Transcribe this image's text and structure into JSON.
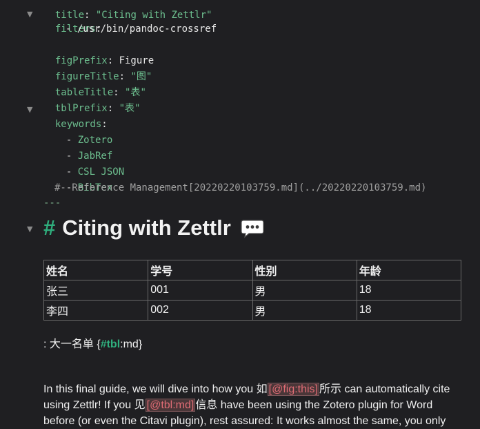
{
  "frontmatter": {
    "title_key": "title",
    "title_value": "\"Citing with Zettlr\"",
    "filters_key": "filters",
    "filter_item": "- /usr/bin/pandoc-crossref",
    "figPrefix_key": "figPrefix",
    "figPrefix_value": "Figure",
    "figureTitle_key": "figureTitle",
    "figureTitle_value": "\"图\"",
    "tableTitle_key": "tableTitle",
    "tableTitle_value": "\"表\"",
    "tblPrefix_key": "tblPrefix",
    "tblPrefix_value": "\"表\"",
    "keywords_key": "keywords",
    "keywords": [
      "Zotero",
      "JabRef",
      "CSL JSON",
      "BibTex"
    ],
    "comment_line": "#- Reference Management[20220220103759.md](../20220220103759.md)",
    "end_marker": "---"
  },
  "heading": {
    "hash": "#",
    "text": "Citing with Zettlr",
    "icon": "speech-bubble-icon"
  },
  "table": {
    "headers": [
      "姓名",
      "学号",
      "性别",
      "年龄"
    ],
    "rows": [
      [
        "张三",
        "001",
        "男",
        "18"
      ],
      [
        "李四",
        "002",
        "男",
        "18"
      ]
    ]
  },
  "caption": {
    "prefix": ": 大一名单 {",
    "tag": "#tbl",
    "suffix": ":md}"
  },
  "paragraph": {
    "p1": "In this final guide, we will dive into how you 如",
    "cite1": "[@fig:this]",
    "p2": "所示 can automatically cite using Zettlr! If you 见",
    "cite2": "[@tbl:md]",
    "p3": "信息 have been using the Zotero plugin for Word before (or even the Citavi plugin), rest assured: It works almost the same, you only"
  },
  "colors": {
    "background": "#1f1f22",
    "accent": "#2fae7d",
    "key": "#6dbf8f",
    "citation": "#e06c75"
  }
}
